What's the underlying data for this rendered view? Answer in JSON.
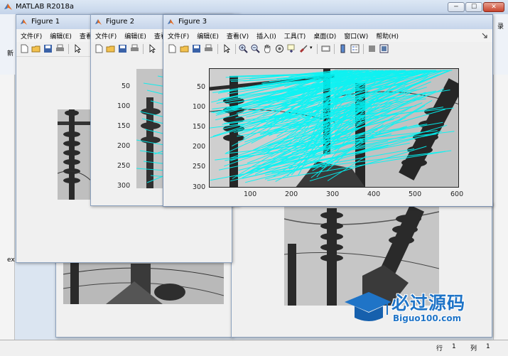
{
  "main_window": {
    "title": "MATLAB R2018a",
    "login_label": "录",
    "side_glyph_top": "新",
    "side_glyph_bottom": "ex",
    "window_buttons": [
      "─",
      "☐",
      "✕"
    ]
  },
  "figures": [
    {
      "title": "Figure 1",
      "menus": [
        "文件(F)",
        "编辑(E)",
        "查看"
      ]
    },
    {
      "title": "Figure 2",
      "menus": [
        "文件(F)",
        "编辑(E)",
        "查看"
      ],
      "y_ticks": [
        "50",
        "100",
        "150",
        "200",
        "250",
        "300"
      ]
    },
    {
      "title": "Figure 3",
      "menus": [
        "文件(F)",
        "编辑(E)",
        "查看(V)",
        "插入(I)",
        "工具(T)",
        "桌面(D)",
        "窗口(W)",
        "帮助(H)"
      ],
      "x_ticks": [
        "100",
        "200",
        "300",
        "400",
        "500",
        "600"
      ],
      "y_ticks": [
        "50",
        "100",
        "150",
        "200",
        "250",
        "300"
      ],
      "toolbar_icons": [
        "new-icon",
        "open-icon",
        "save-icon",
        "print-icon",
        "pointer-icon",
        "zoom-in-icon",
        "zoom-out-icon",
        "pan-icon",
        "rotate-icon",
        "data-cursor-icon",
        "brush-icon",
        "link-icon",
        "colorbar-icon",
        "legend-icon",
        "hide-plot-tools-icon",
        "show-plot-tools-icon"
      ]
    }
  ],
  "status_bar": {
    "row_label": "行",
    "row_value": "1",
    "col_label": "列",
    "col_value": "1"
  },
  "watermark": {
    "cn_text": "必过源码",
    "url_text": "Biguo100.com"
  }
}
